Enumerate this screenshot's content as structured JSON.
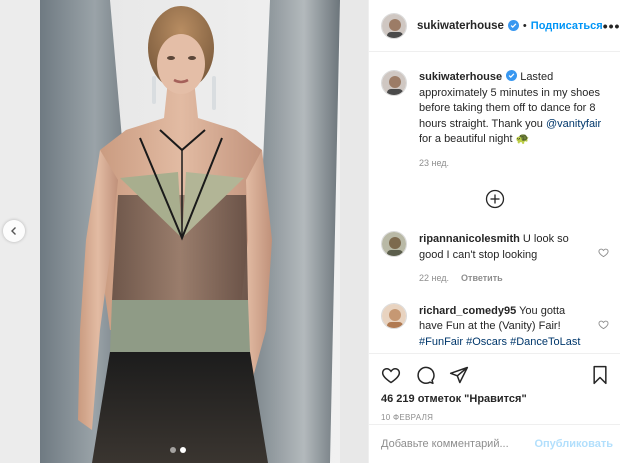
{
  "post": {
    "username": "sukiwaterhouse",
    "follow_label": "Подписаться",
    "separator": "•",
    "more_label": "•••",
    "caption_user": "sukiwaterhouse",
    "caption_text_1": " Lasted approximately 5 minutes in my shoes before taking them off to dance for 8 hours straight. Thank you ",
    "caption_mention": "@vanityfair",
    "caption_text_2": " for a beautiful night ",
    "caption_emoji": "🐢",
    "caption_time": "23 нед.",
    "likes": "46 219 отметок \"Нравится\"",
    "date": "10 ФЕВРАЛЯ"
  },
  "comments": [
    {
      "user": "ripannanicolesmith",
      "text": " U look so good I can't stop looking",
      "time": "22 нед.",
      "reply_label": "Ответить"
    },
    {
      "user": "richard_comedy95",
      "text": " You gotta have Fun at the (Vanity) Fair! ",
      "tags": [
        "#FunFair",
        "#Oscars",
        "#DanceToLast"
      ]
    }
  ],
  "add_comment": {
    "placeholder": "Добавьте комментарий...",
    "publish_label": "Опубликовать"
  },
  "colors": {
    "accent": "#0095f6",
    "verified": "#3897f0",
    "link": "#00376b",
    "muted": "#8e8e8e",
    "publish_disabled": "#b2dffc"
  },
  "icons": [
    "chevron-left-icon",
    "verified-icon",
    "more-icon",
    "plus-circle-icon",
    "heart-icon",
    "comment-icon",
    "share-icon",
    "bookmark-icon"
  ]
}
